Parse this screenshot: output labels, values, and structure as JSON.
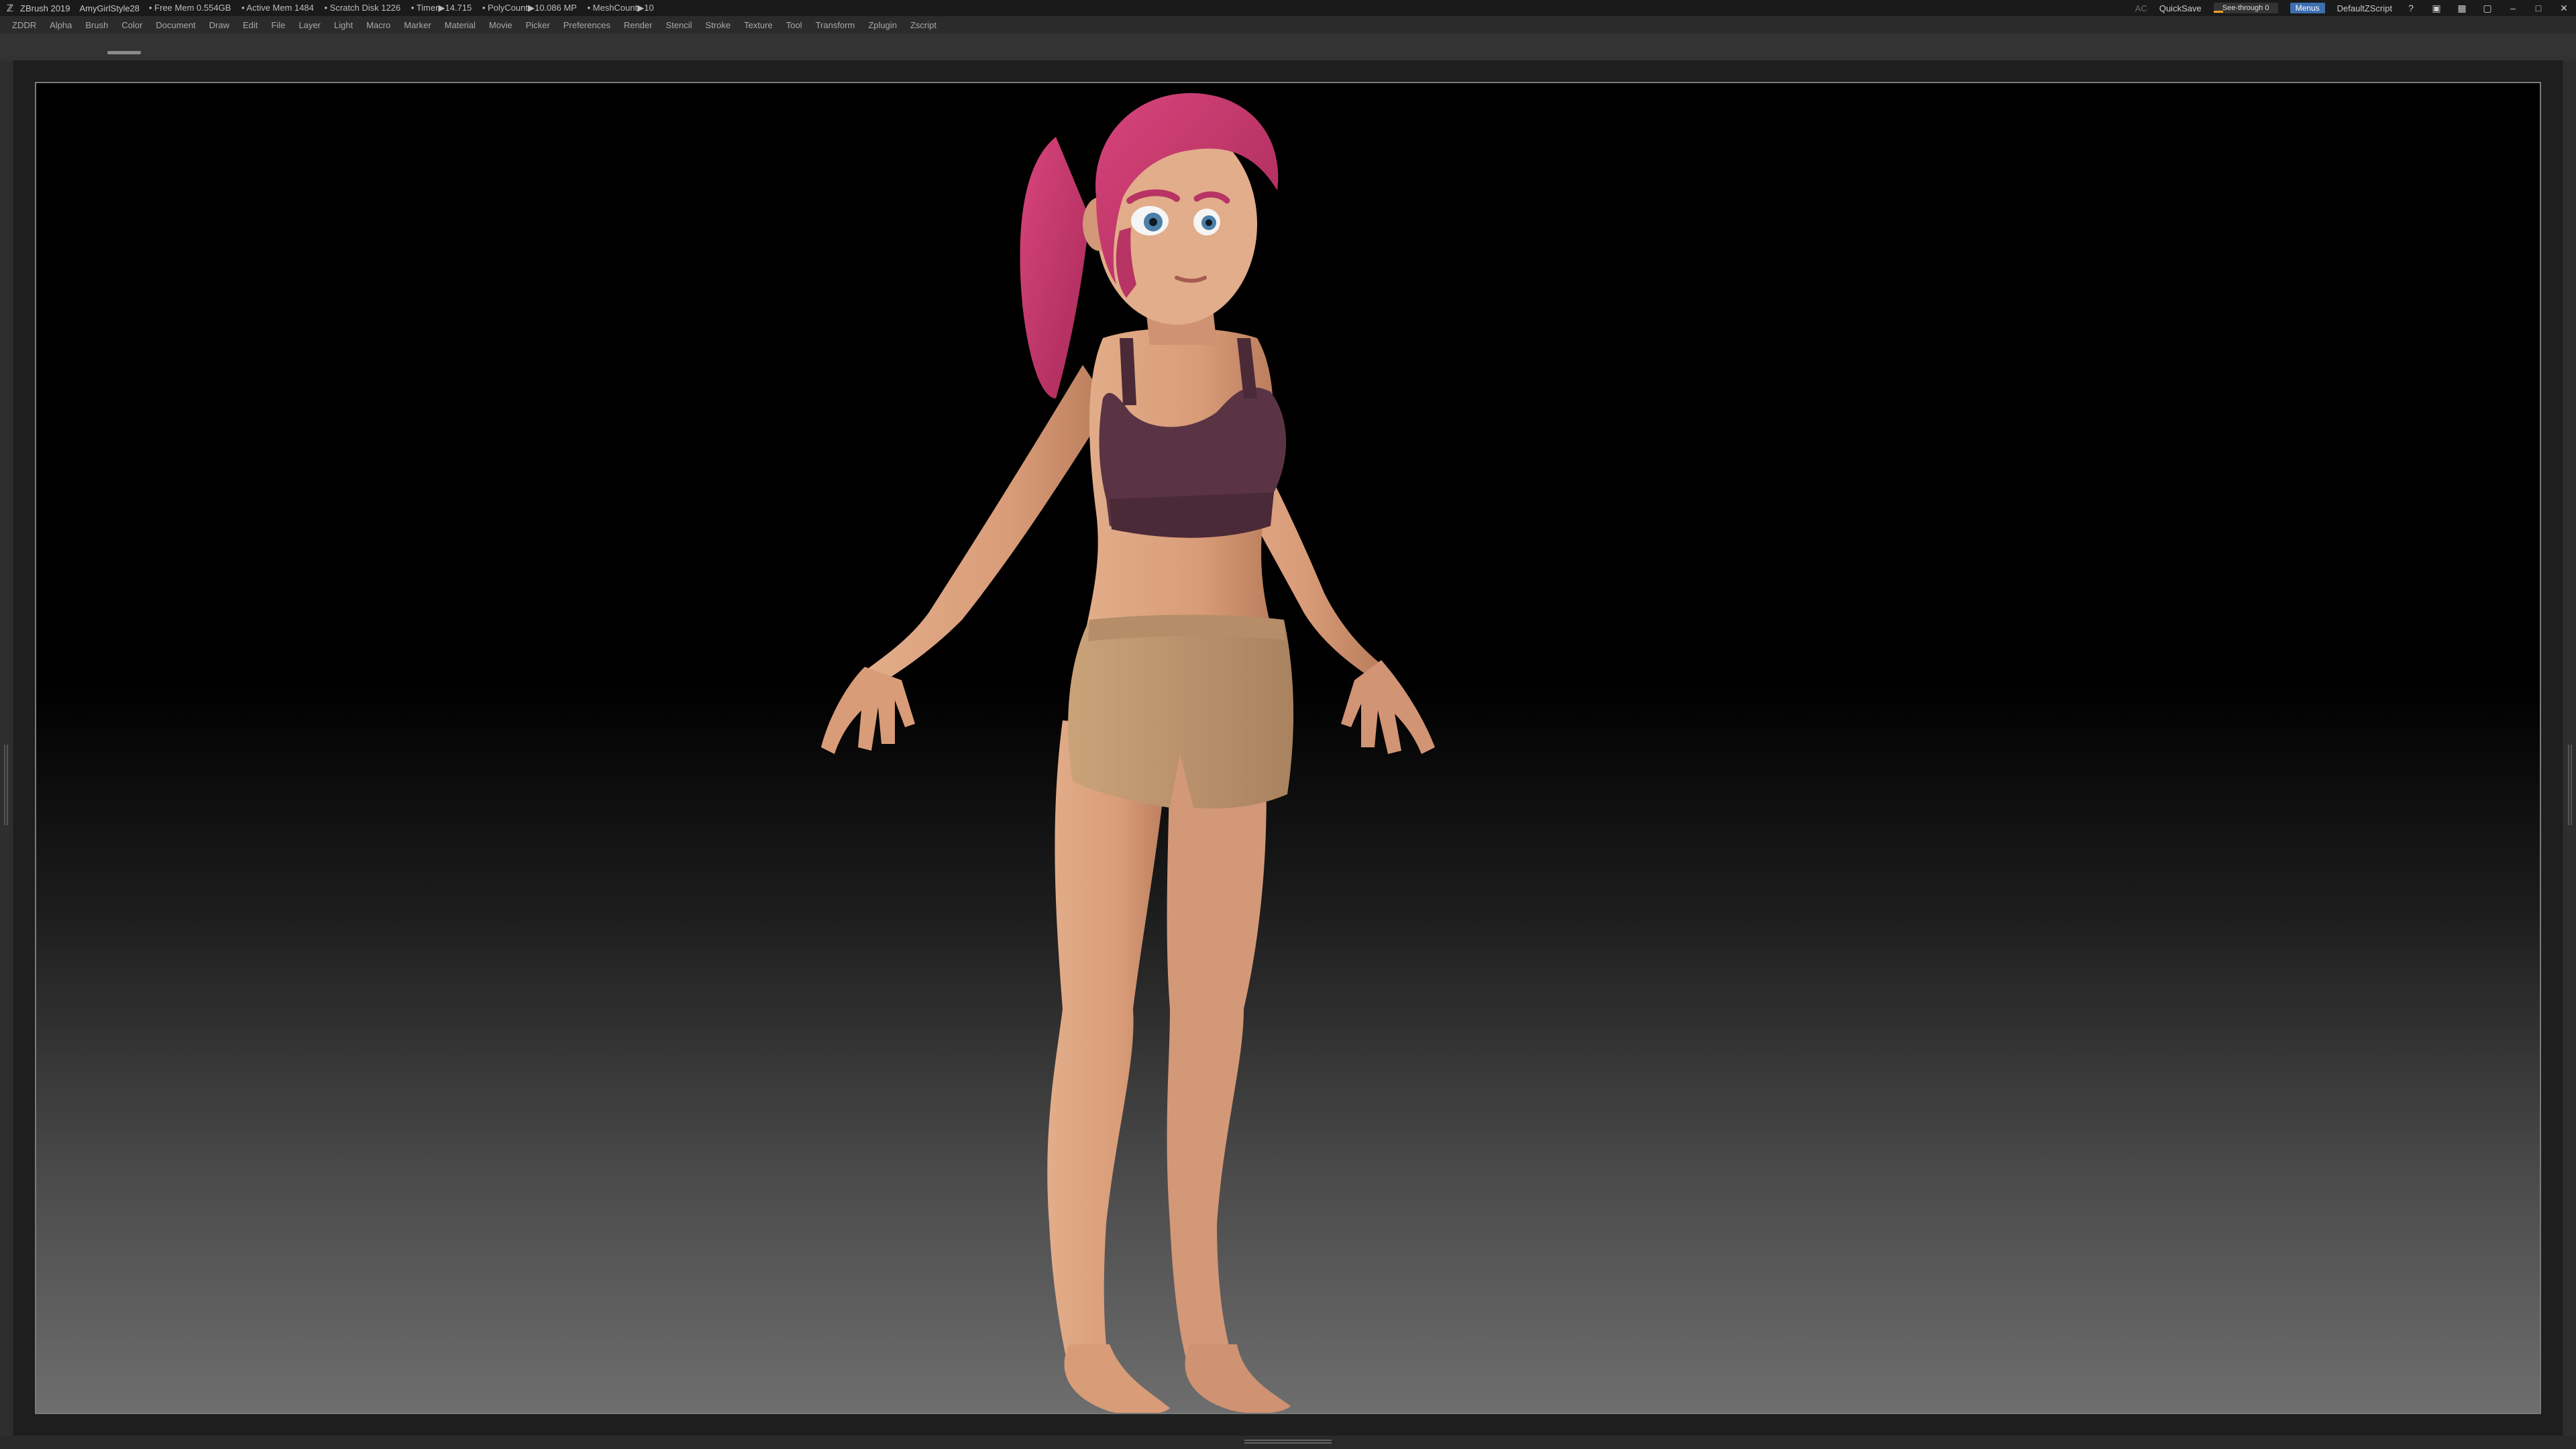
{
  "titlebar": {
    "app_name": "ZBrush 2019",
    "document": "AmyGirlStyle28",
    "stats": [
      "• Free Mem 0.554GB",
      "• Active Mem 1484",
      "• Scratch Disk 1226",
      "• Timer▶14.715",
      "• PolyCount▶10.086 MP",
      "• MeshCount▶10"
    ],
    "ac_label": "AC",
    "quicksave_label": "QuickSave",
    "seethrough_label": "See-through  0",
    "menus_label": "Menus",
    "script_label": "DefaultZScript"
  },
  "menubar": {
    "items": [
      "ZDDR",
      "Alpha",
      "Brush",
      "Color",
      "Document",
      "Draw",
      "Edit",
      "File",
      "Layer",
      "Light",
      "Macro",
      "Marker",
      "Material",
      "Movie",
      "Picker",
      "Preferences",
      "Render",
      "Stencil",
      "Stroke",
      "Texture",
      "Tool",
      "Transform",
      "Zplugin",
      "Zscript"
    ]
  },
  "colors": {
    "skin": "#d9a07c",
    "hair": "#c8386a",
    "top": "#5a3444",
    "shorts": "#c39a72",
    "accent": "#3d6fb0"
  },
  "icons": [
    "zbrush-logo-icon",
    "help-icon",
    "layout-icon",
    "palette-icon",
    "lock-icon",
    "minimize-icon",
    "maximize-icon",
    "close-icon"
  ]
}
